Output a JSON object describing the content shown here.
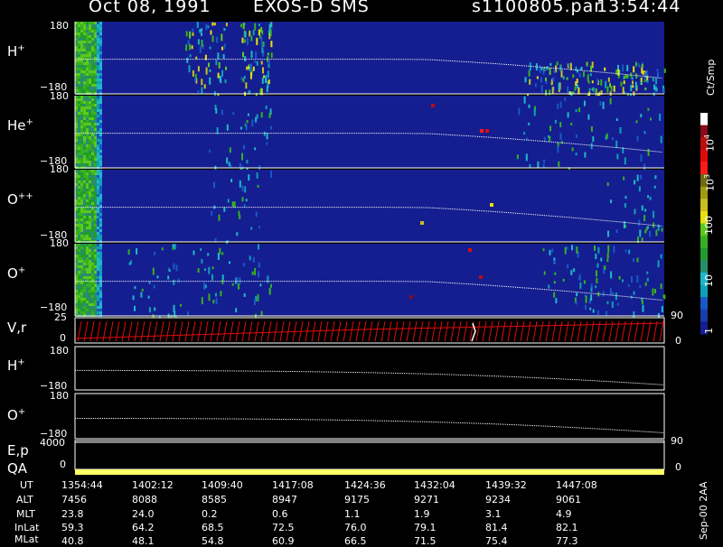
{
  "header": {
    "date": "Oct 08, 1991",
    "mission": "EXOS-D SMS",
    "file": "s1100805.par",
    "time": "13:54:44"
  },
  "chart_data": {
    "type": "heatmap",
    "panels": [
      {
        "ion": "H",
        "charge": "+",
        "ylim": [
          -180,
          180
        ],
        "y_top": "180",
        "y_bottom": "−180"
      },
      {
        "ion": "He",
        "charge": "+",
        "ylim": [
          -180,
          180
        ],
        "y_top": "180",
        "y_bottom": "−180"
      },
      {
        "ion": "O",
        "charge": "++",
        "ylim": [
          -180,
          180
        ],
        "y_top": "180",
        "y_bottom": "−180"
      },
      {
        "ion": "O",
        "charge": "+",
        "ylim": [
          -180,
          180
        ],
        "y_top": "180",
        "y_bottom": "−180"
      }
    ],
    "line_panels": [
      {
        "label": "V,r",
        "ticks": [
          "25",
          "0"
        ],
        "right_tick": "90",
        "right_tick2": "0"
      },
      {
        "label": "H",
        "charge": "+",
        "ticks": [
          "180",
          "−180"
        ]
      },
      {
        "label": "O",
        "charge": "+",
        "ticks": [
          "180",
          "−180"
        ]
      },
      {
        "label": "E,p",
        "ticks": [
          "4000"
        ],
        "right_tick": "90"
      },
      {
        "label": "QA",
        "ticks": [
          "0"
        ],
        "right_tick": "0"
      }
    ],
    "colorbar": {
      "unit": "Ct/Smp",
      "labels": [
        "10^4",
        "10^3",
        "100",
        "10",
        "1"
      ],
      "colors": [
        "#ffffff",
        "#8a0a1a",
        "#b80e0e",
        "#e00a0a",
        "#ff1a1a",
        "#6e6a10",
        "#a09a10",
        "#c8c020",
        "#e8e010",
        "#5cc81e",
        "#38b020",
        "#209c2c",
        "#2a8c6e",
        "#20b8c8",
        "#10a0b8",
        "#1858c8",
        "#183ca8",
        "#141e90"
      ]
    },
    "time_axis": {
      "UT": [
        "1354:44",
        "1402:12",
        "1409:40",
        "1417:08",
        "1424:36",
        "1432:04",
        "1439:32",
        "1447:08"
      ],
      "ALT": [
        "7456",
        "8088",
        "8585",
        "8947",
        "9175",
        "9271",
        "9234",
        "9061"
      ],
      "MLT": [
        "23.8",
        "24.0",
        "0.2",
        "0.6",
        "1.1",
        "1.9",
        "3.1",
        "4.9"
      ],
      "InLat": [
        "59.3",
        "64.2",
        "68.5",
        "72.5",
        "76.0",
        "79.1",
        "81.4",
        "82.1"
      ],
      "MLat": [
        "40.8",
        "48.1",
        "54.8",
        "60.9",
        "66.5",
        "71.5",
        "75.4",
        "77.3"
      ]
    },
    "footer_labels": [
      "UT",
      "ALT",
      "MLT",
      "InLat",
      "MLat"
    ],
    "stamp": "Sep-00 2AA"
  }
}
